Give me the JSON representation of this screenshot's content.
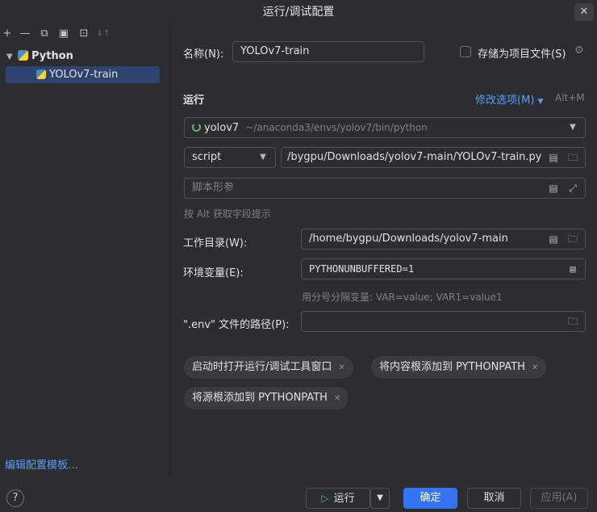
{
  "window": {
    "title": "运行/调试配置",
    "close_glyph": "✕"
  },
  "toolbar": {
    "icons": [
      "add-icon",
      "remove-icon",
      "copy-icon",
      "save-icon",
      "folder-move-icon",
      "sort-icon"
    ],
    "glyphs": [
      "+",
      "—",
      "⧉",
      "▣",
      "⊡",
      "↓↑"
    ]
  },
  "tree": {
    "group_label": "Python",
    "items": [
      {
        "label": "YOLOv7-train"
      }
    ]
  },
  "form": {
    "name_label": "名称(N):",
    "name_value": "YOLOv7-train",
    "store_as_file_label": "存储为项目文件(S)",
    "run_section": "运行",
    "modify_options": "修改选项(M)",
    "modify_shortcut": "Alt+M",
    "interpreter_name": "yolov7",
    "interpreter_path": "~/anaconda3/envs/yolov7/bin/python",
    "script_type": "script",
    "script_path": "/bygpu/Downloads/yolov7-main/YOLOv7-train.py",
    "script_params_placeholder": "脚本形参",
    "alt_hint": "按 Alt 获取字段提示",
    "workdir_label": "工作目录(W):",
    "workdir_value": "/home/bygpu/Downloads/yolov7-main",
    "env_label": "环境变量(E):",
    "env_value": "PYTHONUNBUFFERED=1",
    "env_hint": "用分号分隔变量: VAR=value; VAR1=value1",
    "dotenv_label": "\".env\" 文件的路径(P):",
    "dotenv_value": ""
  },
  "chips": [
    {
      "label": "启动时打开运行/调试工具窗口"
    },
    {
      "label": "将内容根添加到 PYTHONPATH"
    },
    {
      "label": "将源根添加到 PYTHONPATH"
    }
  ],
  "footer": {
    "edit_templates": "编辑配置模板…",
    "help": "?",
    "run_label": "运行",
    "ok_label": "确定",
    "cancel_label": "取消",
    "apply_label": "应用(A)"
  },
  "colors": {
    "accent": "#3574f0",
    "link": "#589df6",
    "run_green": "#5fb865"
  }
}
